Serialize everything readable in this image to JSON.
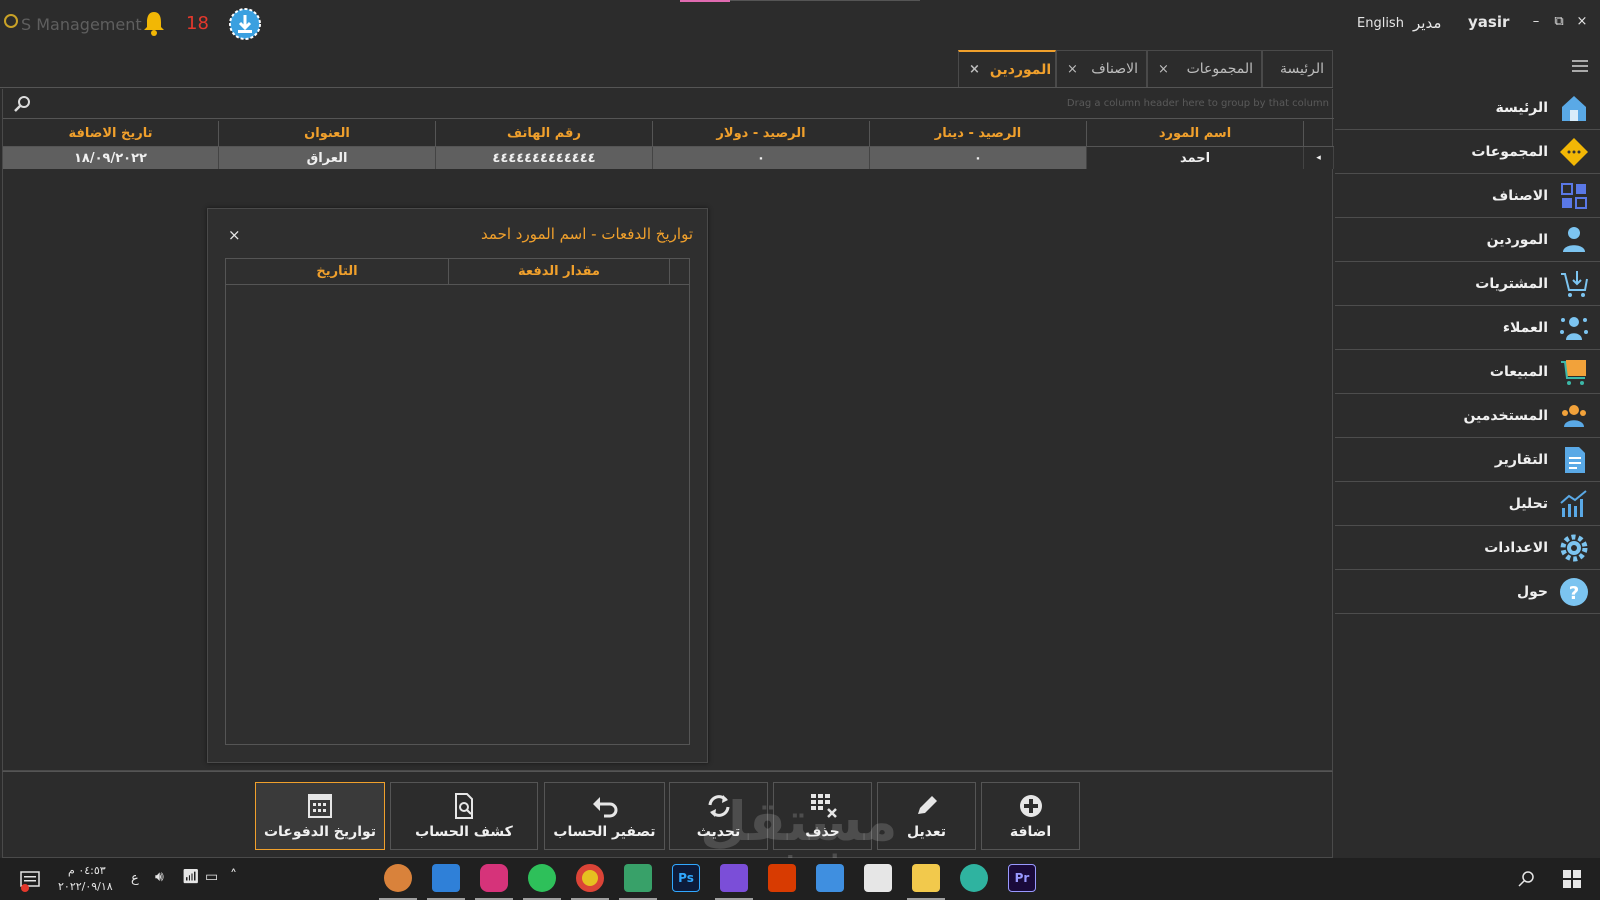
{
  "titlebar": {
    "app_title": "S Management",
    "notification_count": "18",
    "language_label": "English",
    "role_label": "مدير",
    "username": "yasir",
    "minimize": "–",
    "restore": "⧉",
    "close": "×"
  },
  "tabs": [
    {
      "label": "الرئيسة",
      "closable": false
    },
    {
      "label": "المجموعات",
      "closable": true
    },
    {
      "label": "الاصناف",
      "closable": true
    },
    {
      "label": "الموردين",
      "closable": true,
      "active": true
    }
  ],
  "tab_close_glyph": "×",
  "sidebar": {
    "items": [
      {
        "label": "الرئيسة",
        "icon": "home-icon"
      },
      {
        "label": "المجموعات",
        "icon": "groups-icon"
      },
      {
        "label": "الاصناف",
        "icon": "items-grid-icon"
      },
      {
        "label": "الموردين",
        "icon": "supplier-icon"
      },
      {
        "label": "المشتريات",
        "icon": "cart-download-icon"
      },
      {
        "label": "العملاء",
        "icon": "customers-icon"
      },
      {
        "label": "المبيعات",
        "icon": "sales-cart-icon"
      },
      {
        "label": "المستخدمين",
        "icon": "users-icon"
      },
      {
        "label": "التقارير",
        "icon": "report-icon"
      },
      {
        "label": "تحليل",
        "icon": "analytics-chart-icon"
      },
      {
        "label": "الاعدادات",
        "icon": "settings-gear-icon"
      },
      {
        "label": "حول",
        "icon": "help-question-icon"
      }
    ]
  },
  "grid": {
    "group_hint": "Drag a column header here to group by that column",
    "columns": [
      "اسم المورد",
      "الرصيد - دينار",
      "الرصيد - دولار",
      "رقم الهاتف",
      "العنوان",
      "تاريخ الاضافة"
    ],
    "rows": [
      [
        "احمد",
        "٠",
        "٠",
        "٤٤٤٤٤٤٤٤٤٤٤٤٤",
        "العراق",
        "١٨/٠٩/٢٠٢٢"
      ]
    ]
  },
  "dialog": {
    "title": "تواريخ الدفعات - اسم المورد  احمد",
    "close": "×",
    "columns": [
      "مقدار الدفعة",
      "التاريخ"
    ]
  },
  "toolbar": {
    "buttons": [
      {
        "label": "اضافة",
        "icon": "plus-circle-icon"
      },
      {
        "label": "تعديل",
        "icon": "pencil-icon"
      },
      {
        "label": "حذف",
        "icon": "delete-grid-icon"
      },
      {
        "label": "تحديث",
        "icon": "refresh-icon"
      },
      {
        "label": "تصفير الحساب",
        "icon": "undo-icon"
      },
      {
        "label": "كشف الحساب",
        "icon": "document-search-icon"
      },
      {
        "label": "تواريخ الدفوعات",
        "icon": "calendar-icon",
        "active": true
      }
    ]
  },
  "watermark": {
    "arabic": "مستقل",
    "latin": "mostaql.com"
  },
  "taskbar": {
    "time": "٠٤:٥٣ م",
    "date": "٢٠٢٢/٠٩/١٨",
    "input_lang": "ع",
    "apps": [
      "browser-icon",
      "video-player-icon",
      "instagram-icon",
      "whatsapp-icon",
      "chrome-icon",
      "snipping-icon",
      "photoshop-icon",
      "visual-studio-icon",
      "office-icon",
      "mail-icon",
      "store-icon",
      "file-explorer-icon",
      "edge-icon",
      "premiere-icon"
    ],
    "photoshop_label": "Ps",
    "premiere_label": "Pr"
  },
  "colors": {
    "accent": "#f0a02c",
    "background": "#2c2c2c",
    "notification": "#e4382c"
  }
}
